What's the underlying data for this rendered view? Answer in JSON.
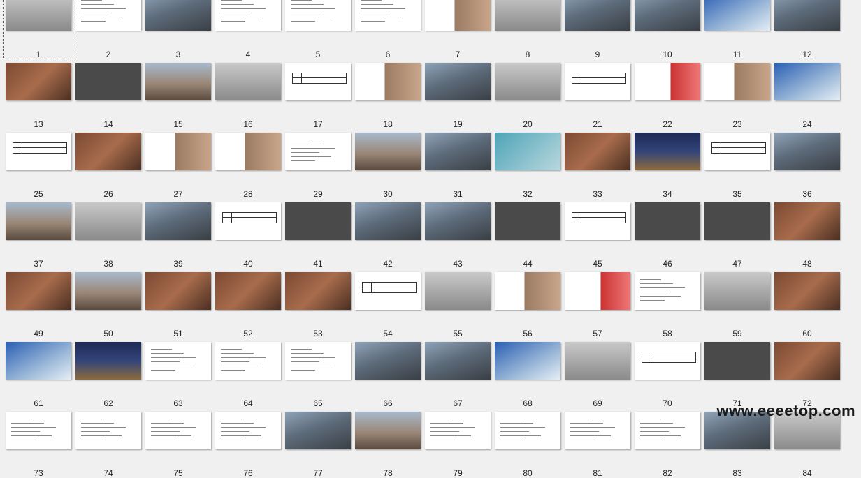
{
  "slides": [
    {
      "n": "1",
      "style": "v-grey"
    },
    {
      "n": "2",
      "style": "v-doc"
    },
    {
      "n": "3",
      "style": "v-photo"
    },
    {
      "n": "4",
      "style": "v-doc"
    },
    {
      "n": "5",
      "style": "v-doc"
    },
    {
      "n": "6",
      "style": "v-doc"
    },
    {
      "n": "7",
      "style": "v-mixed"
    },
    {
      "n": "8",
      "style": "v-grey"
    },
    {
      "n": "9",
      "style": "v-photo"
    },
    {
      "n": "10",
      "style": "v-photo"
    },
    {
      "n": "11",
      "style": "v-blue"
    },
    {
      "n": "12",
      "style": "v-photo"
    },
    {
      "n": "13",
      "style": "v-brick"
    },
    {
      "n": "14",
      "style": "v-dark"
    },
    {
      "n": "15",
      "style": "v-photo2"
    },
    {
      "n": "16",
      "style": "v-grey"
    },
    {
      "n": "17",
      "style": "v-table"
    },
    {
      "n": "18",
      "style": "v-mixed"
    },
    {
      "n": "19",
      "style": "v-photo"
    },
    {
      "n": "20",
      "style": "v-grey"
    },
    {
      "n": "21",
      "style": "v-table"
    },
    {
      "n": "22",
      "style": "v-red"
    },
    {
      "n": "23",
      "style": "v-mixed"
    },
    {
      "n": "24",
      "style": "v-blue"
    },
    {
      "n": "25",
      "style": "v-table"
    },
    {
      "n": "26",
      "style": "v-brick"
    },
    {
      "n": "27",
      "style": "v-mixed"
    },
    {
      "n": "28",
      "style": "v-mixed"
    },
    {
      "n": "29",
      "style": "v-doc"
    },
    {
      "n": "30",
      "style": "v-photo2"
    },
    {
      "n": "31",
      "style": "v-photo"
    },
    {
      "n": "32",
      "style": "v-cyan"
    },
    {
      "n": "33",
      "style": "v-brick"
    },
    {
      "n": "34",
      "style": "v-night"
    },
    {
      "n": "35",
      "style": "v-table"
    },
    {
      "n": "36",
      "style": "v-photo"
    },
    {
      "n": "37",
      "style": "v-photo2"
    },
    {
      "n": "38",
      "style": "v-grey"
    },
    {
      "n": "39",
      "style": "v-photo"
    },
    {
      "n": "40",
      "style": "v-table"
    },
    {
      "n": "41",
      "style": "v-dark"
    },
    {
      "n": "42",
      "style": "v-photo"
    },
    {
      "n": "43",
      "style": "v-photo"
    },
    {
      "n": "44",
      "style": "v-dark"
    },
    {
      "n": "45",
      "style": "v-table"
    },
    {
      "n": "46",
      "style": "v-dark"
    },
    {
      "n": "47",
      "style": "v-dark"
    },
    {
      "n": "48",
      "style": "v-brick"
    },
    {
      "n": "49",
      "style": "v-brick"
    },
    {
      "n": "50",
      "style": "v-photo2"
    },
    {
      "n": "51",
      "style": "v-brick"
    },
    {
      "n": "52",
      "style": "v-brick"
    },
    {
      "n": "53",
      "style": "v-brick"
    },
    {
      "n": "54",
      "style": "v-table"
    },
    {
      "n": "55",
      "style": "v-grey"
    },
    {
      "n": "56",
      "style": "v-mixed"
    },
    {
      "n": "57",
      "style": "v-red"
    },
    {
      "n": "58",
      "style": "v-doc"
    },
    {
      "n": "59",
      "style": "v-grey"
    },
    {
      "n": "60",
      "style": "v-brick"
    },
    {
      "n": "61",
      "style": "v-blue"
    },
    {
      "n": "62",
      "style": "v-night"
    },
    {
      "n": "63",
      "style": "v-doc"
    },
    {
      "n": "64",
      "style": "v-doc"
    },
    {
      "n": "65",
      "style": "v-doc"
    },
    {
      "n": "66",
      "style": "v-photo"
    },
    {
      "n": "67",
      "style": "v-photo"
    },
    {
      "n": "68",
      "style": "v-blue"
    },
    {
      "n": "69",
      "style": "v-grey"
    },
    {
      "n": "70",
      "style": "v-table"
    },
    {
      "n": "71",
      "style": "v-dark"
    },
    {
      "n": "72",
      "style": "v-brick"
    },
    {
      "n": "73",
      "style": "v-doc"
    },
    {
      "n": "74",
      "style": "v-doc"
    },
    {
      "n": "75",
      "style": "v-doc"
    },
    {
      "n": "76",
      "style": "v-doc"
    },
    {
      "n": "77",
      "style": "v-photo"
    },
    {
      "n": "78",
      "style": "v-photo2"
    },
    {
      "n": "79",
      "style": "v-doc"
    },
    {
      "n": "80",
      "style": "v-doc"
    },
    {
      "n": "81",
      "style": "v-doc"
    },
    {
      "n": "82",
      "style": "v-doc"
    },
    {
      "n": "83",
      "style": "v-photo"
    },
    {
      "n": "84",
      "style": "v-grey"
    }
  ],
  "selected_slide": "1",
  "watermark": "www.eeeetop.com"
}
